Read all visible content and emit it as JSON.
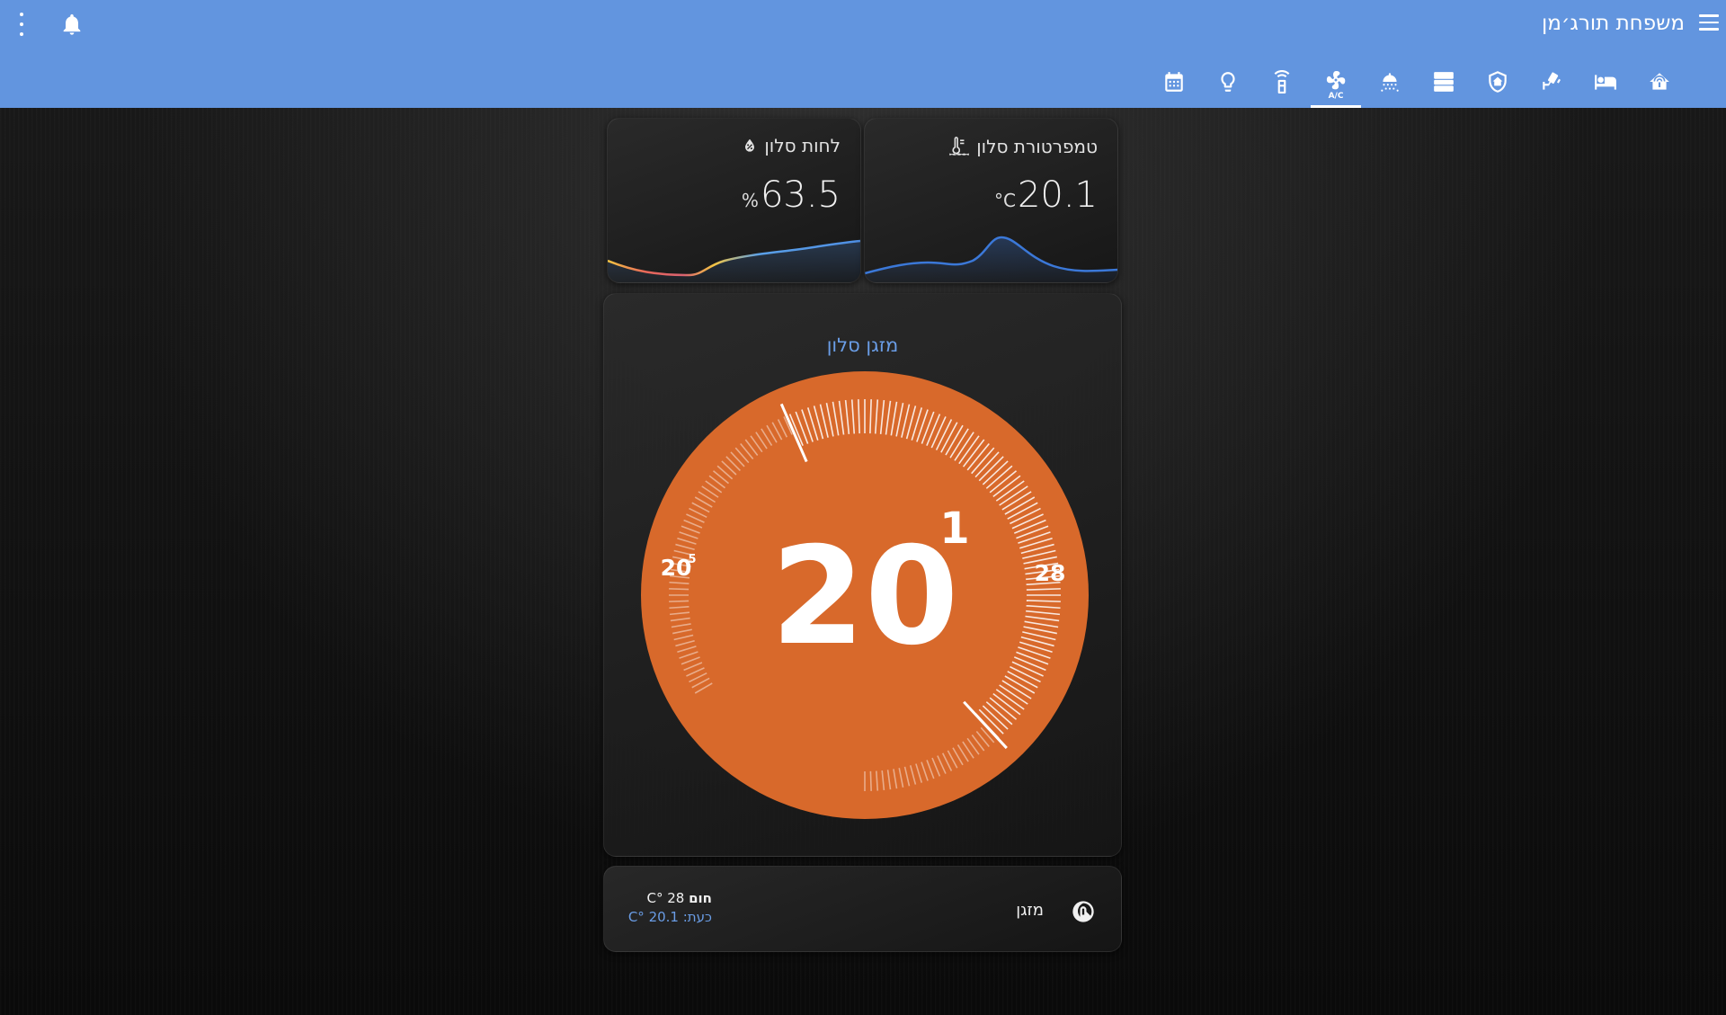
{
  "header": {
    "title": "משפחת תורג׳מן",
    "tabs": [
      {
        "name": "tab-calendar",
        "icon": "calendar-icon",
        "active": false
      },
      {
        "name": "tab-lights",
        "icon": "lightbulb-icon",
        "active": false
      },
      {
        "name": "tab-remote",
        "icon": "remote-icon",
        "active": false
      },
      {
        "name": "tab-ac",
        "icon": "air-conditioner-icon",
        "label": "A/C",
        "active": true
      },
      {
        "name": "tab-shower",
        "icon": "shower-icon",
        "active": false
      },
      {
        "name": "tab-server",
        "icon": "server-icon",
        "active": false
      },
      {
        "name": "tab-security",
        "icon": "shield-home-icon",
        "active": false
      },
      {
        "name": "tab-camera",
        "icon": "cctv-icon",
        "active": false
      },
      {
        "name": "tab-bedroom",
        "icon": "bed-icon",
        "active": false
      },
      {
        "name": "tab-home",
        "icon": "home-automation-icon",
        "active": false
      }
    ]
  },
  "sensors": {
    "humidity": {
      "title": "לחות סלון",
      "value": "63.5",
      "unit": "%",
      "icon": "water-percent-icon"
    },
    "temperature": {
      "title": "טמפרטורת סלון",
      "value": "20.1",
      "unit": "°C",
      "icon": "thermometer-water-icon"
    }
  },
  "thermostat": {
    "name": "מזגן סלון",
    "current_whole": "20",
    "current_decimal": "1",
    "ambient_whole": "20",
    "ambient_decimal": "5",
    "target": "28",
    "min": 16,
    "max": 30,
    "color": "#d8692b"
  },
  "climate_row": {
    "label": "מזגן",
    "icon": "thermostat-icon",
    "mode": "חום",
    "target": "28 °C",
    "current": "כעת: 20.1 °C"
  },
  "colors": {
    "header": "#6295df",
    "accent": "#6a9de6",
    "dial": "#d8692b"
  }
}
